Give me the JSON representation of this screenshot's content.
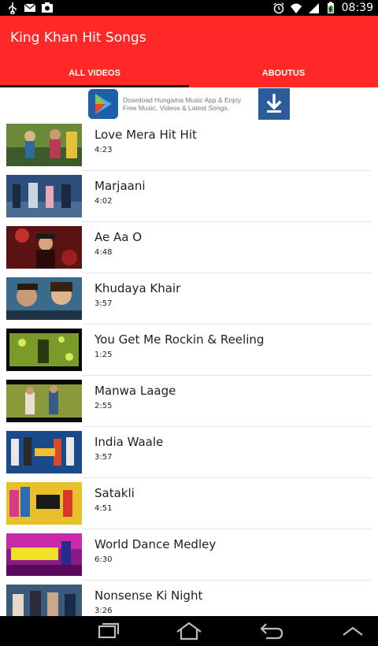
{
  "status_bar": {
    "time": "08:39",
    "left_icons": [
      "usb-icon",
      "mail-icon",
      "photo-icon"
    ],
    "right_icons": [
      "alarm-icon",
      "wifi-icon",
      "signal-icon",
      "battery-icon"
    ]
  },
  "app": {
    "title": "King Khan Hit Songs",
    "colors": {
      "appbar": "#ff2828",
      "tab_indicator": "#1a1a1a"
    }
  },
  "tabs": [
    {
      "label": "ALL VIDEOS",
      "selected": true
    },
    {
      "label": "ABOUTUS",
      "selected": false
    }
  ],
  "ad": {
    "text": "Download Hungama Music App & Enjoy Free Music, Videos & Latest Songs.",
    "icon": "download-icon"
  },
  "videos": [
    {
      "title": "Love Mera Hit Hit",
      "duration": "4:23"
    },
    {
      "title": "Marjaani",
      "duration": "4:02"
    },
    {
      "title": "Ae Aa O",
      "duration": "4:48"
    },
    {
      "title": "Khudaya Khair",
      "duration": "3:57"
    },
    {
      "title": "You Get Me Rockin & Reeling",
      "duration": "1:25"
    },
    {
      "title": "Manwa Laage",
      "duration": "2:55"
    },
    {
      "title": "India Waale",
      "duration": "3:57"
    },
    {
      "title": "Satakli",
      "duration": "4:51"
    },
    {
      "title": "World Dance Medley",
      "duration": "6:30"
    },
    {
      "title": "Nonsense Ki Night",
      "duration": "3:26"
    }
  ],
  "nav_bar": {
    "buttons": [
      "recent-apps-icon",
      "home-icon",
      "back-icon",
      "up-arrow-icon"
    ]
  }
}
